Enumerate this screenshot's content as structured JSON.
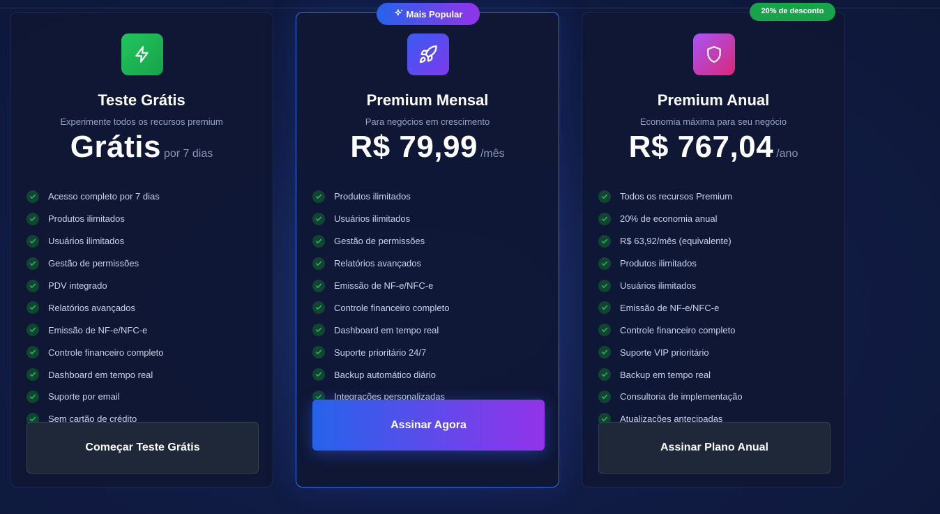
{
  "badges": {
    "popular": "Mais Popular",
    "discount": "20% de desconto"
  },
  "colors": {
    "check_bg": "#124433",
    "check_mark": "#22c55e",
    "accent_gradient_start": "#2563eb",
    "accent_gradient_end": "#9333ea"
  },
  "plans": [
    {
      "icon": "lightning-icon",
      "title": "Teste Grátis",
      "subtitle": "Experimente todos os recursos premium",
      "price": "Grátis",
      "period": "por 7 dias",
      "features": [
        "Acesso completo por 7 dias",
        "Produtos ilimitados",
        "Usuários ilimitados",
        "Gestão de permissões",
        "PDV integrado",
        "Relatórios avançados",
        "Emissão de NF-e/NFC-e",
        "Controle financeiro completo",
        "Dashboard em tempo real",
        "Suporte por email",
        "Sem cartão de crédito"
      ],
      "button": "Começar Teste Grátis"
    },
    {
      "icon": "rocket-icon",
      "title": "Premium Mensal",
      "subtitle": "Para negócios em crescimento",
      "price": "R$ 79,99",
      "period": "/mês",
      "features": [
        "Produtos ilimitados",
        "Usuários ilimitados",
        "Gestão de permissões",
        "Relatórios avançados",
        "Emissão de NF-e/NFC-e",
        "Controle financeiro completo",
        "Dashboard em tempo real",
        "Suporte prioritário 24/7",
        "Backup automático diário",
        "Integrações personalizadas"
      ],
      "button": "Assinar Agora"
    },
    {
      "icon": "shield-icon",
      "title": "Premium Anual",
      "subtitle": "Economia máxima para seu negócio",
      "price": "R$ 767,04",
      "period": "/ano",
      "features": [
        "Todos os recursos Premium",
        "20% de economia anual",
        "R$ 63,92/mês (equivalente)",
        "Produtos ilimitados",
        "Usuários ilimitados",
        "Emissão de NF-e/NFC-e",
        "Controle financeiro completo",
        "Suporte VIP prioritário",
        "Backup em tempo real",
        "Consultoria de implementação",
        "Atualizações antecipadas"
      ],
      "button": "Assinar Plano Anual"
    }
  ]
}
